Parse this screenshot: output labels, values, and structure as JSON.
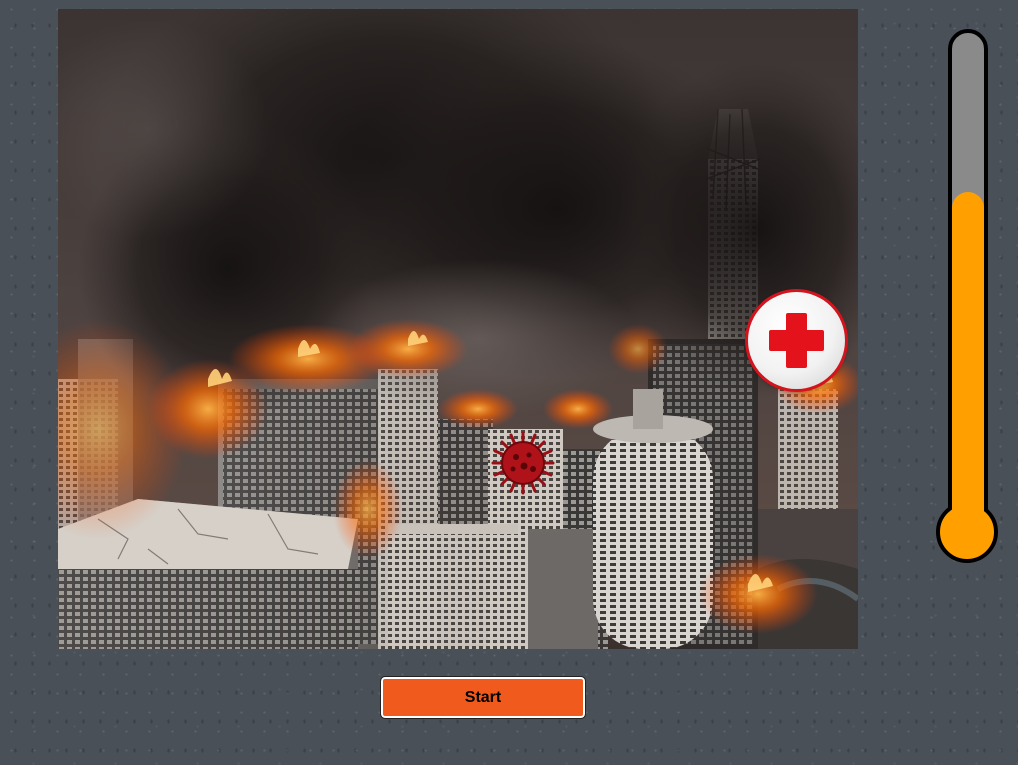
{
  "game": {
    "scene": "burning-city",
    "start_label": "Start"
  },
  "thermometer": {
    "level": 0.7,
    "fill_color": "#ffa000",
    "empty_color": "#8a8a8a"
  },
  "colors": {
    "start_button": "#f05a1c",
    "medkit_cross": "#e3121b",
    "virus": "#b0121a"
  },
  "icons": {
    "medkit": "medkit-icon",
    "virus": "virus-icon"
  }
}
